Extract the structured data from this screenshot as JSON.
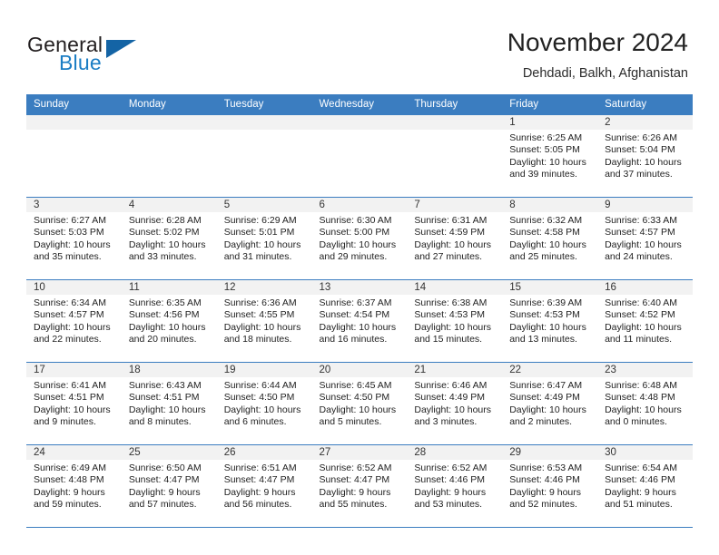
{
  "brand": {
    "word1": "General",
    "word2": "Blue",
    "logo_icon": "triangle-flag-icon"
  },
  "header": {
    "title": "November 2024",
    "location": "Dehdadi, Balkh, Afghanistan"
  },
  "theme": {
    "header_blue": "#3b7dc0",
    "brand_blue": "#1b7dc4",
    "daynum_band": "#f2f2f2",
    "text": "#222222"
  },
  "calendar": {
    "weekday_headers": [
      "Sunday",
      "Monday",
      "Tuesday",
      "Wednesday",
      "Thursday",
      "Friday",
      "Saturday"
    ],
    "labels": {
      "sunrise": "Sunrise:",
      "sunset": "Sunset:",
      "daylight": "Daylight:"
    },
    "weeks": [
      [
        {
          "day": "",
          "sunrise": "",
          "sunset": "",
          "daylight": "",
          "empty": true
        },
        {
          "day": "",
          "sunrise": "",
          "sunset": "",
          "daylight": "",
          "empty": true
        },
        {
          "day": "",
          "sunrise": "",
          "sunset": "",
          "daylight": "",
          "empty": true
        },
        {
          "day": "",
          "sunrise": "",
          "sunset": "",
          "daylight": "",
          "empty": true
        },
        {
          "day": "",
          "sunrise": "",
          "sunset": "",
          "daylight": "",
          "empty": true
        },
        {
          "day": "1",
          "sunrise": "Sunrise: 6:25 AM",
          "sunset": "Sunset: 5:05 PM",
          "daylight": "Daylight: 10 hours and 39 minutes."
        },
        {
          "day": "2",
          "sunrise": "Sunrise: 6:26 AM",
          "sunset": "Sunset: 5:04 PM",
          "daylight": "Daylight: 10 hours and 37 minutes."
        }
      ],
      [
        {
          "day": "3",
          "sunrise": "Sunrise: 6:27 AM",
          "sunset": "Sunset: 5:03 PM",
          "daylight": "Daylight: 10 hours and 35 minutes."
        },
        {
          "day": "4",
          "sunrise": "Sunrise: 6:28 AM",
          "sunset": "Sunset: 5:02 PM",
          "daylight": "Daylight: 10 hours and 33 minutes."
        },
        {
          "day": "5",
          "sunrise": "Sunrise: 6:29 AM",
          "sunset": "Sunset: 5:01 PM",
          "daylight": "Daylight: 10 hours and 31 minutes."
        },
        {
          "day": "6",
          "sunrise": "Sunrise: 6:30 AM",
          "sunset": "Sunset: 5:00 PM",
          "daylight": "Daylight: 10 hours and 29 minutes."
        },
        {
          "day": "7",
          "sunrise": "Sunrise: 6:31 AM",
          "sunset": "Sunset: 4:59 PM",
          "daylight": "Daylight: 10 hours and 27 minutes."
        },
        {
          "day": "8",
          "sunrise": "Sunrise: 6:32 AM",
          "sunset": "Sunset: 4:58 PM",
          "daylight": "Daylight: 10 hours and 25 minutes."
        },
        {
          "day": "9",
          "sunrise": "Sunrise: 6:33 AM",
          "sunset": "Sunset: 4:57 PM",
          "daylight": "Daylight: 10 hours and 24 minutes."
        }
      ],
      [
        {
          "day": "10",
          "sunrise": "Sunrise: 6:34 AM",
          "sunset": "Sunset: 4:57 PM",
          "daylight": "Daylight: 10 hours and 22 minutes."
        },
        {
          "day": "11",
          "sunrise": "Sunrise: 6:35 AM",
          "sunset": "Sunset: 4:56 PM",
          "daylight": "Daylight: 10 hours and 20 minutes."
        },
        {
          "day": "12",
          "sunrise": "Sunrise: 6:36 AM",
          "sunset": "Sunset: 4:55 PM",
          "daylight": "Daylight: 10 hours and 18 minutes."
        },
        {
          "day": "13",
          "sunrise": "Sunrise: 6:37 AM",
          "sunset": "Sunset: 4:54 PM",
          "daylight": "Daylight: 10 hours and 16 minutes."
        },
        {
          "day": "14",
          "sunrise": "Sunrise: 6:38 AM",
          "sunset": "Sunset: 4:53 PM",
          "daylight": "Daylight: 10 hours and 15 minutes."
        },
        {
          "day": "15",
          "sunrise": "Sunrise: 6:39 AM",
          "sunset": "Sunset: 4:53 PM",
          "daylight": "Daylight: 10 hours and 13 minutes."
        },
        {
          "day": "16",
          "sunrise": "Sunrise: 6:40 AM",
          "sunset": "Sunset: 4:52 PM",
          "daylight": "Daylight: 10 hours and 11 minutes."
        }
      ],
      [
        {
          "day": "17",
          "sunrise": "Sunrise: 6:41 AM",
          "sunset": "Sunset: 4:51 PM",
          "daylight": "Daylight: 10 hours and 9 minutes."
        },
        {
          "day": "18",
          "sunrise": "Sunrise: 6:43 AM",
          "sunset": "Sunset: 4:51 PM",
          "daylight": "Daylight: 10 hours and 8 minutes."
        },
        {
          "day": "19",
          "sunrise": "Sunrise: 6:44 AM",
          "sunset": "Sunset: 4:50 PM",
          "daylight": "Daylight: 10 hours and 6 minutes."
        },
        {
          "day": "20",
          "sunrise": "Sunrise: 6:45 AM",
          "sunset": "Sunset: 4:50 PM",
          "daylight": "Daylight: 10 hours and 5 minutes."
        },
        {
          "day": "21",
          "sunrise": "Sunrise: 6:46 AM",
          "sunset": "Sunset: 4:49 PM",
          "daylight": "Daylight: 10 hours and 3 minutes."
        },
        {
          "day": "22",
          "sunrise": "Sunrise: 6:47 AM",
          "sunset": "Sunset: 4:49 PM",
          "daylight": "Daylight: 10 hours and 2 minutes."
        },
        {
          "day": "23",
          "sunrise": "Sunrise: 6:48 AM",
          "sunset": "Sunset: 4:48 PM",
          "daylight": "Daylight: 10 hours and 0 minutes."
        }
      ],
      [
        {
          "day": "24",
          "sunrise": "Sunrise: 6:49 AM",
          "sunset": "Sunset: 4:48 PM",
          "daylight": "Daylight: 9 hours and 59 minutes."
        },
        {
          "day": "25",
          "sunrise": "Sunrise: 6:50 AM",
          "sunset": "Sunset: 4:47 PM",
          "daylight": "Daylight: 9 hours and 57 minutes."
        },
        {
          "day": "26",
          "sunrise": "Sunrise: 6:51 AM",
          "sunset": "Sunset: 4:47 PM",
          "daylight": "Daylight: 9 hours and 56 minutes."
        },
        {
          "day": "27",
          "sunrise": "Sunrise: 6:52 AM",
          "sunset": "Sunset: 4:47 PM",
          "daylight": "Daylight: 9 hours and 55 minutes."
        },
        {
          "day": "28",
          "sunrise": "Sunrise: 6:52 AM",
          "sunset": "Sunset: 4:46 PM",
          "daylight": "Daylight: 9 hours and 53 minutes."
        },
        {
          "day": "29",
          "sunrise": "Sunrise: 6:53 AM",
          "sunset": "Sunset: 4:46 PM",
          "daylight": "Daylight: 9 hours and 52 minutes."
        },
        {
          "day": "30",
          "sunrise": "Sunrise: 6:54 AM",
          "sunset": "Sunset: 4:46 PM",
          "daylight": "Daylight: 9 hours and 51 minutes."
        }
      ]
    ]
  }
}
